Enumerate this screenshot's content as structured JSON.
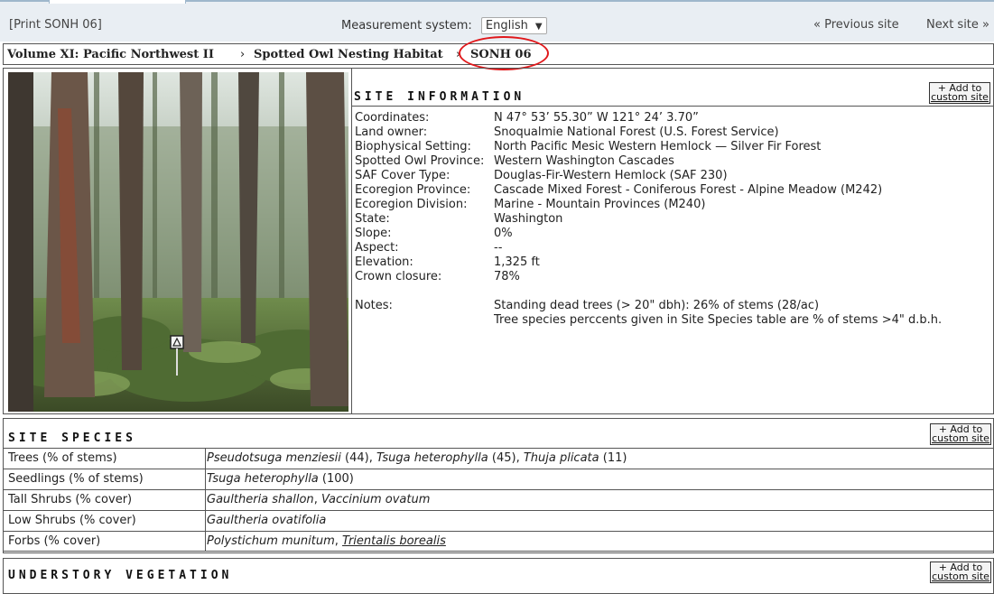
{
  "toolbar": {
    "print_label": "[Print SONH 06]",
    "measurement_label": "Measurement system:",
    "measurement_value": "English",
    "prev_label": "« Previous site",
    "next_label": "Next site »"
  },
  "breadcrumb": {
    "volume": "Volume XI:  Pacific Northwest II",
    "section": "Spotted Owl Nesting Habitat",
    "current": "SONH 06",
    "separator": "›"
  },
  "add_button": {
    "line1": "+ Add to",
    "line2": "custom site"
  },
  "site_info": {
    "title": "SITE INFORMATION",
    "rows": [
      {
        "label": "Coordinates:",
        "value": "N 47°  53’  55.30”  W 121°  24’  3.70”"
      },
      {
        "label": "Land owner:",
        "value": "Snoqualmie National Forest (U.S. Forest Service)"
      },
      {
        "label": "Biophysical Setting:",
        "value": "North Pacific Mesic Western Hemlock — Silver Fir Forest"
      },
      {
        "label": "Spotted Owl Province:",
        "value": "Western Washington Cascades"
      },
      {
        "label": "SAF Cover Type:",
        "value": "Douglas-Fir-Western Hemlock (SAF 230)"
      },
      {
        "label": "Ecoregion Province:",
        "value": "Cascade Mixed Forest - Coniferous Forest - Alpine Meadow (M242)"
      },
      {
        "label": "Ecoregion Division:",
        "value": "Marine - Mountain Provinces (M240)"
      },
      {
        "label": "State:",
        "value": "Washington"
      },
      {
        "label": "Slope:",
        "value": "0%"
      },
      {
        "label": "Aspect:",
        "value": "--"
      },
      {
        "label": "Elevation:",
        "value": "1,325 ft"
      },
      {
        "label": "Crown closure:",
        "value": "78%"
      }
    ],
    "notes_label": "Notes:",
    "notes": [
      "Standing dead trees (> 20\" dbh): 26% of stems (28/ac)",
      "Tree species perccents given in Site Species table are % of stems >4\" d.b.h."
    ]
  },
  "site_species": {
    "title": "SITE SPECIES",
    "rows": [
      {
        "category": "Trees (% of stems)",
        "items": [
          {
            "name": "Pseudotsuga menziesii",
            "pct": " (44)"
          },
          {
            "name": "Tsuga heterophylla",
            "pct": " (45)"
          },
          {
            "name": "Thuja plicata",
            "pct": " (11)"
          }
        ]
      },
      {
        "category": "Seedlings (% of stems)",
        "items": [
          {
            "name": "Tsuga heterophylla",
            "pct": " (100)"
          }
        ]
      },
      {
        "category": "Tall Shrubs (% cover)",
        "items": [
          {
            "name": "Gaultheria shallon",
            "pct": ""
          },
          {
            "name": "Vaccinium ovatum",
            "pct": ""
          }
        ]
      },
      {
        "category": "Low Shrubs (% cover)",
        "items": [
          {
            "name": "Gaultheria ovatifolia",
            "pct": ""
          }
        ]
      },
      {
        "category": "Forbs (% cover)",
        "items": [
          {
            "name": "Polystichum munitum",
            "pct": ""
          },
          {
            "name": "Trientalis borealis",
            "pct": "",
            "link": true
          }
        ]
      }
    ]
  },
  "understory": {
    "title": "UNDERSTORY VEGETATION"
  }
}
